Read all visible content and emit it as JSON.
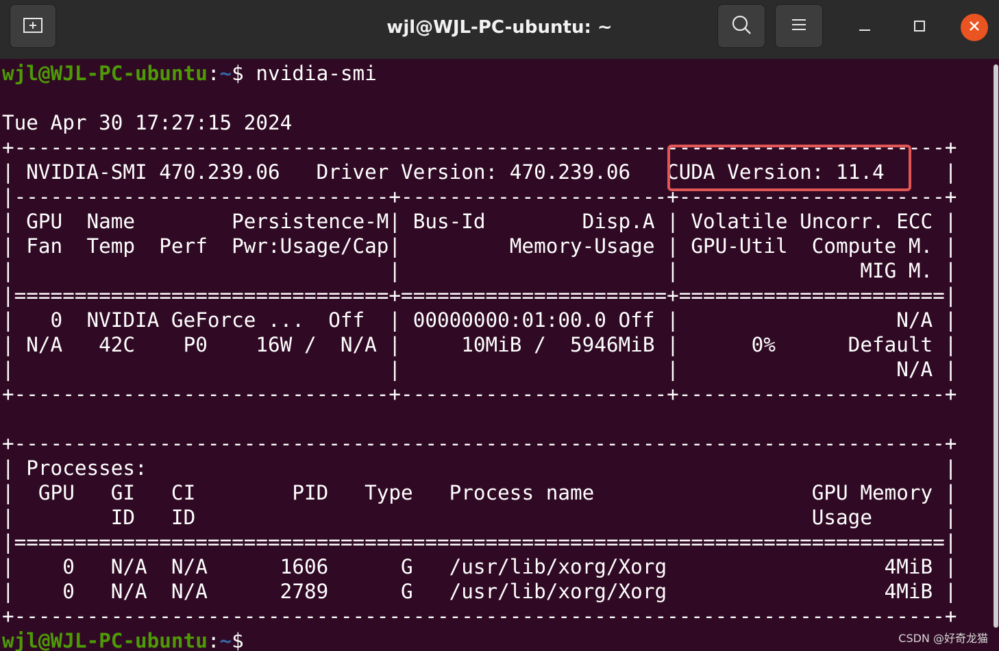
{
  "window": {
    "title": "wjl@WJL-PC-ubuntu: ~"
  },
  "prompt": {
    "user_host": "wjl@WJL-PC-ubuntu",
    "sep": ":",
    "path": "~",
    "symbol": "$ ",
    "command": "nvidia-smi"
  },
  "output": [
    "",
    "Tue Apr 30 17:27:15 2024",
    "+-----------------------------------------------------------------------------+",
    "| NVIDIA-SMI 470.239.06   Driver Version: 470.239.06   CUDA Version: 11.4     |",
    "|-------------------------------+----------------------+----------------------+",
    "| GPU  Name        Persistence-M| Bus-Id        Disp.A | Volatile Uncorr. ECC |",
    "| Fan  Temp  Perf  Pwr:Usage/Cap|         Memory-Usage | GPU-Util  Compute M. |",
    "|                               |                      |               MIG M. |",
    "|===============================+======================+======================|",
    "|   0  NVIDIA GeForce ...  Off  | 00000000:01:00.0 Off |                  N/A |",
    "| N/A   42C    P0    16W /  N/A |     10MiB /  5946MiB |      0%      Default |",
    "|                               |                      |                  N/A |",
    "+-------------------------------+----------------------+----------------------+",
    "",
    "+-----------------------------------------------------------------------------+",
    "| Processes:                                                                  |",
    "|  GPU   GI   CI        PID   Type   Process name                  GPU Memory |",
    "|        ID   ID                                                   Usage      |",
    "|=============================================================================|",
    "|    0   N/A  N/A      1606      G   /usr/lib/xorg/Xorg                  4MiB |",
    "|    0   N/A  N/A      2789      G   /usr/lib/xorg/Xorg                  4MiB |",
    "+-----------------------------------------------------------------------------+"
  ],
  "watermark": "CSDN @好奇龙猫",
  "colors": {
    "background": "#300a24",
    "prompt_user": "#4e9a06",
    "prompt_path": "#3465a4",
    "highlight_box": "#e35656",
    "close_button": "#e95420"
  },
  "icons": {
    "new_tab": "new-tab-icon",
    "search": "search-icon",
    "menu": "hamburger-menu-icon",
    "minimize": "minimize-icon",
    "maximize": "maximize-icon",
    "close": "close-icon"
  }
}
